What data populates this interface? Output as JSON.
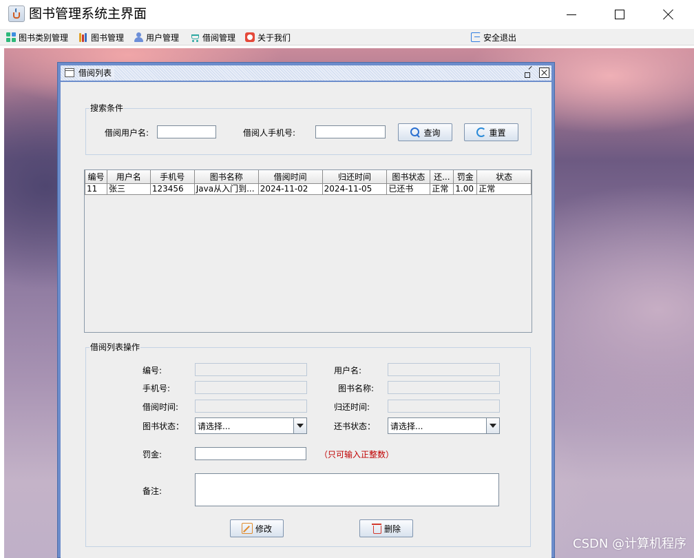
{
  "window": {
    "title": "图书管理系统主界面"
  },
  "menubar": {
    "items": [
      {
        "label": "图书类别管理",
        "icon": "grid-icon"
      },
      {
        "label": "图书管理",
        "icon": "books-icon"
      },
      {
        "label": "用户管理",
        "icon": "user-icon"
      },
      {
        "label": "借阅管理",
        "icon": "cart-icon"
      },
      {
        "label": "关于我们",
        "icon": "smile-icon"
      }
    ],
    "exit_label": "安全退出"
  },
  "internal_frame": {
    "title": "借阅列表"
  },
  "search": {
    "group_title": "搜索条件",
    "username_label": "借阅用户名:",
    "username_value": "",
    "phone_label": "借阅人手机号:",
    "phone_value": "",
    "query_button": "查询",
    "reset_button": "重置"
  },
  "table": {
    "columns": [
      "编号",
      "用户名",
      "手机号",
      "图书名称",
      "借阅时间",
      "归还时间",
      "图书状态",
      "还...",
      "罚金",
      "状态"
    ],
    "rows": [
      [
        "11",
        "张三",
        "123456",
        "Java从入门到...",
        "2024-11-02",
        "2024-11-05",
        "已还书",
        "正常",
        "1.00",
        "正常"
      ]
    ]
  },
  "ops": {
    "group_title": "借阅列表操作",
    "id_label": "编号:",
    "username_label": "用户名:",
    "phone_label": "手机号:",
    "bookname_label": "图书名称:",
    "borrow_time_label": "借阅时间:",
    "return_time_label": "归还时间:",
    "book_status_label": "图书状态：",
    "book_status_value": "请选择...",
    "return_status_label": "还书状态：",
    "return_status_value": "请选择...",
    "fine_label": "罚金:",
    "fine_value": "",
    "fine_hint": "（只可输入正整数）",
    "note_label": "备注:",
    "note_value": "",
    "edit_button": "修改",
    "delete_button": "删除"
  },
  "watermark": "CSDN @计算机程序",
  "colors": {
    "frame_border": "#6b8ccb",
    "hint": "#c00000",
    "panel_bg": "#eeeeee"
  }
}
